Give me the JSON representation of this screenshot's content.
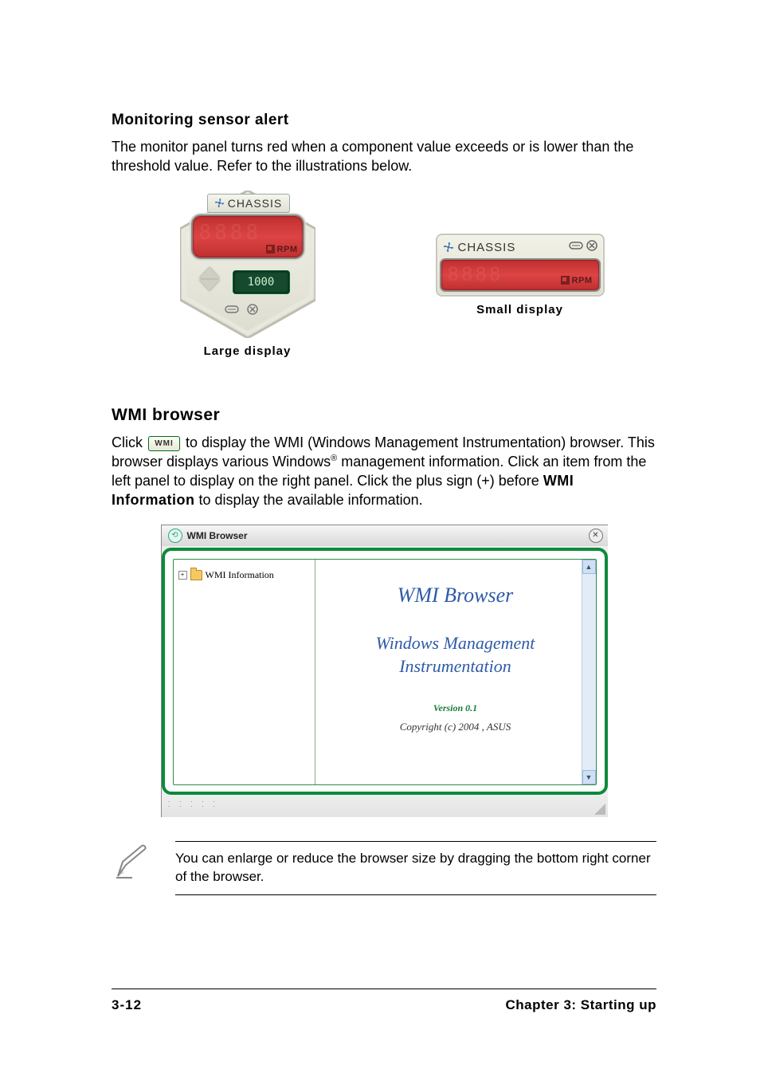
{
  "section1": {
    "heading": "Monitoring sensor alert",
    "paragraph": "The monitor panel turns red when a component value exceeds or is lower than the threshold value. Refer to the illustrations below."
  },
  "large_gauge": {
    "title": "CHASSIS",
    "rpm_label": "RPM",
    "threshold_value": "1000",
    "caption": "Large display"
  },
  "small_gauge": {
    "title": "CHASSIS",
    "rpm_label": "RPM",
    "caption": "Small display"
  },
  "section2": {
    "heading": "WMI browser",
    "text_parts": {
      "t1": "Click ",
      "button_label": "WMI",
      "t2": " to display the WMI (Windows Management Instrumentation) browser. This browser displays various Windows",
      "reg": "®",
      "t3": " management information. Click an item from the left panel to display on the right panel. Click the plus sign (+) before ",
      "bold": "WMI Information",
      "t4": " to display the available information."
    }
  },
  "wmi_window": {
    "title": "WMI Browser",
    "tree_root": "WMI Information",
    "right": {
      "title": "WMI Browser",
      "subtitle": "Windows Management Instrumentation",
      "version": "Version 0.1",
      "copyright": "Copyright (c) 2004 , ASUS"
    }
  },
  "note": "You can enlarge or reduce the browser size by dragging the bottom right corner of the browser.",
  "footer": {
    "page": "3-12",
    "chapter": "Chapter 3: Starting up"
  }
}
